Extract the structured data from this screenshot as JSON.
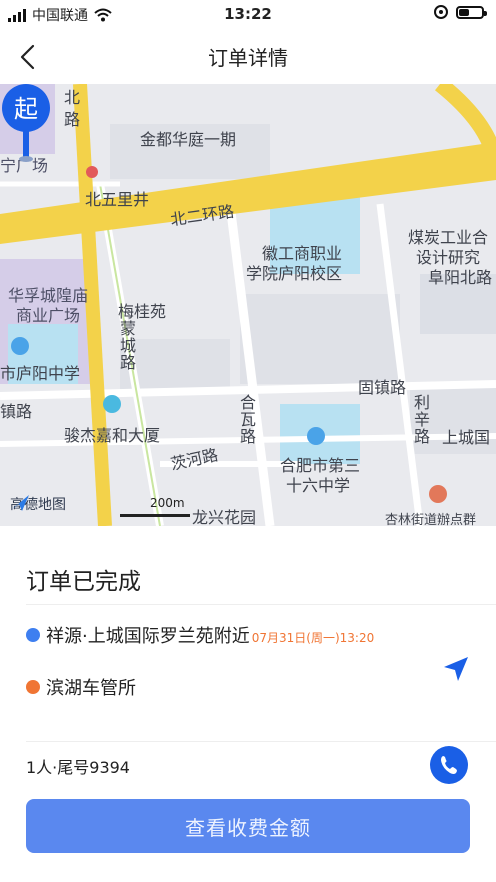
{
  "status_bar": {
    "carrier": "中国联通",
    "time": "13:22",
    "battery_level": 0.4,
    "icons": [
      "signal-icon",
      "wifi-icon",
      "orientation-lock-icon",
      "battery-icon"
    ]
  },
  "nav": {
    "title": "订单详情",
    "back_icon": "chevron-left-icon"
  },
  "map": {
    "labels": {
      "road_north": "北",
      "road_north2": "路",
      "jindu": "金都华庭一期",
      "ning_plaza": "宁广场",
      "beiwuli": "北五里井",
      "ring_road": "北二环路",
      "school_1": "徽工商职业",
      "school_2": "学院庐阳校区",
      "coal_1": "煤炭工业合",
      "coal_2": "设计研究",
      "coal_3": "阜阳北路",
      "huafu_1": "华孚城隍庙",
      "huafu_2": "商业广场",
      "meiguiyuan": "梅桂苑",
      "mengcheng": "蒙城路",
      "luyang_school": "市庐阳中学",
      "zhen_road": "镇路",
      "gu_zhen": "固镇路",
      "hefei_road": "合瓦路",
      "lixin": "利辛路",
      "shangcheng": "上城国",
      "junjie": "骏杰嘉和大厦",
      "cihe": "茨河路",
      "no36_1": "合肥市第三",
      "no36_2": "十六中学",
      "longxing": "龙兴花园",
      "xinglin": "杏林街道辦点群"
    },
    "pin_label": "起",
    "logo_text": "高德地图",
    "scale_text": "200m",
    "colors": {
      "background": "#e9eaee",
      "road_major": "#f3d24a",
      "road_minor": "#ffffff",
      "water_blue": "#b8e1f2",
      "commercial": "#d5cde8",
      "pin": "#1a5fe6"
    }
  },
  "order": {
    "status_title": "订单已完成",
    "start": {
      "dot_color": "#3e7ff0",
      "address": "祥源·上城国际罗兰苑附近",
      "time": "07月31日(周一)13:20"
    },
    "end": {
      "dot_color": "#f07534",
      "address": "滨湖车管所"
    },
    "navigate_icon": "navigation-arrow-icon",
    "passenger_info": "1人·尾号9394",
    "phone_icon": "phone-icon",
    "fee_button": "查看收费金额",
    "accent_color": "#1a5fe6",
    "button_color": "#5a88ef"
  }
}
